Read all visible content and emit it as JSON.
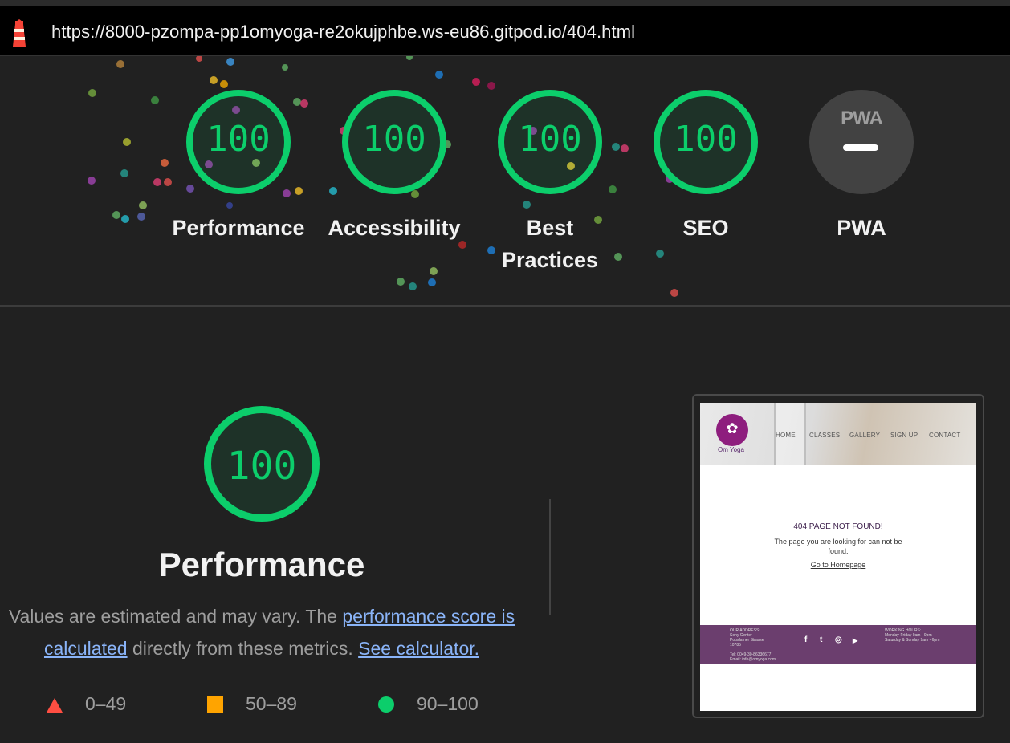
{
  "browser": {
    "url": "https://8000-pzompa-pp1omyoga-re2okujphbe.ws-eu86.gitpod.io/404.html",
    "icon": "lighthouse-icon"
  },
  "scores": [
    {
      "label": "Performance",
      "score": "100"
    },
    {
      "label": "Accessibility",
      "score": "100"
    },
    {
      "label": "Best Practices",
      "score": "100"
    },
    {
      "label": "SEO",
      "score": "100"
    },
    {
      "label": "PWA",
      "score": "",
      "logo_text": "PWA"
    }
  ],
  "performance": {
    "score": "100",
    "title": "Performance",
    "desc_prefix": "Values are estimated and may vary. The ",
    "link_score": "performance score is calculated",
    "desc_middle": " directly from these metrics. ",
    "link_calculator": "See calculator."
  },
  "legend": [
    {
      "icon": "triangle-icon",
      "range": "0–49",
      "color": "#ff4e42"
    },
    {
      "icon": "square-icon",
      "range": "50–89",
      "color": "#ffa400"
    },
    {
      "icon": "circle-icon",
      "range": "90–100",
      "color": "#0cce6b"
    }
  ],
  "thumbnail": {
    "brand": "Om Yoga",
    "nav": [
      "HOME",
      "CLASSES",
      "GALLERY",
      "SIGN UP",
      "CONTACT"
    ],
    "heading": "404 PAGE NOT FOUND!",
    "message": "The page you are looking for can not be found.",
    "link": "Go to Homepage",
    "footer_address": "OUR ADDRESS:\nSony Center\nPotsdamer Strasse\n10785\n\nTel: 0049-30-86336677\nEmail: info@omyoga.com",
    "footer_hours": "WORKING HOURS:\nMonday-Friday 9am - 9pm\nSaturday & Sunday 9am - 6pm",
    "social": [
      "f",
      "t",
      "◎",
      "▶"
    ]
  },
  "colors": {
    "pass": "#0cce6b",
    "average": "#ffa400",
    "fail": "#ff4e42",
    "link": "#8ab4f8"
  }
}
